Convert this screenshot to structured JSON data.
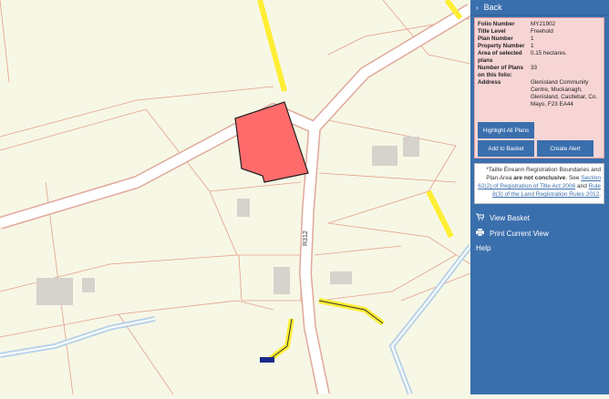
{
  "map": {
    "road_label": "R312",
    "colors": {
      "background": "#f7f7e6",
      "road": "#e0a89a",
      "boundary": "#e3a08a",
      "plot": "#ff6b6b",
      "yellow": "#ffee33",
      "river": "#b9d3e8"
    }
  },
  "panel": {
    "back_label": "Back",
    "folio": {
      "rows": [
        {
          "key": "Folio Number",
          "value": "MY21902"
        },
        {
          "key": "Title Level",
          "value": "Freehold"
        },
        {
          "key": "Plan Number",
          "value": "1"
        },
        {
          "key": "Property Number",
          "value": "1"
        },
        {
          "key": "Area of selected plans",
          "value": "0.15 hectares."
        },
        {
          "key": "Number of Plans on this folio:",
          "value": "33"
        },
        {
          "key": "Address",
          "value": "Glenisland Community Centre, Muckanagh, Glenisland, Castlebar, Co. Mayo, F23 EA44"
        }
      ]
    },
    "buttons": {
      "highlight_all": "Highlight All Plans",
      "add_to_basket": "Add to Basket",
      "create_alert": "Create Alert"
    },
    "disclaimer": {
      "part1": "*Tailte Éireann Registration Boundaries and Plan Area ",
      "bold": "are not conclusive",
      "part2": ". See ",
      "link1": "Section 62(2) of Registration of Title Act 2006",
      "part3": " and ",
      "link2": "Rule 8(3) of the Land Registration Rules 2012",
      "part4": "."
    },
    "menu": {
      "view_basket": "View Basket",
      "print_view": "Print Current View",
      "help": "Help"
    }
  }
}
